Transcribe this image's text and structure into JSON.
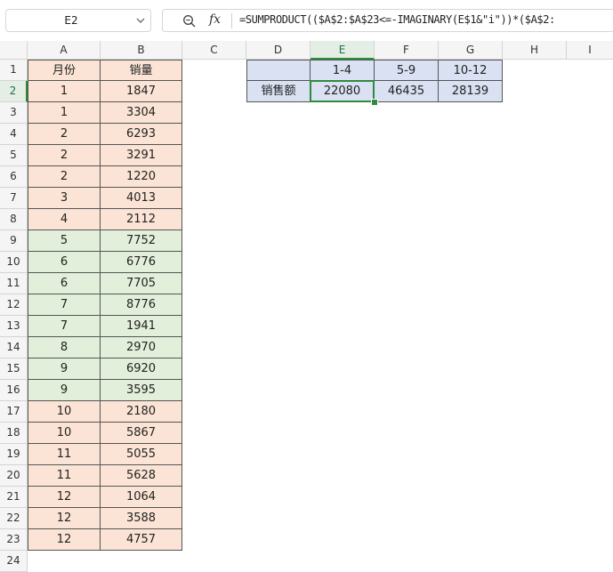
{
  "formula_bar": {
    "name_box": "E2",
    "fx_label": "fx",
    "formula": "=SUMPRODUCT(($A$2:$A$23<=-IMAGINARY(E$1&\"i\"))*($A$2:"
  },
  "columns": [
    "A",
    "B",
    "C",
    "D",
    "E",
    "F",
    "G",
    "H",
    "I"
  ],
  "rows": [
    "1",
    "2",
    "3",
    "4",
    "5",
    "6",
    "7",
    "8",
    "9",
    "10",
    "11",
    "12",
    "13",
    "14",
    "15",
    "16",
    "17",
    "18",
    "19",
    "20",
    "21",
    "22",
    "23",
    "24"
  ],
  "active_cell": "E2",
  "table": {
    "header_month": "月份",
    "header_sales": "销量",
    "month": [
      1,
      1,
      2,
      2,
      2,
      3,
      4,
      5,
      6,
      6,
      7,
      7,
      8,
      9,
      9,
      10,
      10,
      11,
      11,
      12,
      12,
      12
    ],
    "sales": [
      1847,
      3304,
      6293,
      3291,
      1220,
      4013,
      2112,
      7752,
      6776,
      7705,
      8776,
      1941,
      2970,
      6920,
      3595,
      2180,
      5867,
      5055,
      5628,
      1064,
      3588,
      4757
    ],
    "fill_colors": {
      "peach": "#fbe4d5",
      "green": "#e2efda"
    }
  },
  "summary": {
    "row_label": "销售额",
    "ranges": [
      "1-4",
      "5-9",
      "10-12"
    ],
    "values": [
      22080,
      46435,
      28139
    ],
    "header_color": "#d9e1f2"
  },
  "colors": {
    "selection": "#2e8b3e",
    "header_bg": "#f5f5f5"
  }
}
